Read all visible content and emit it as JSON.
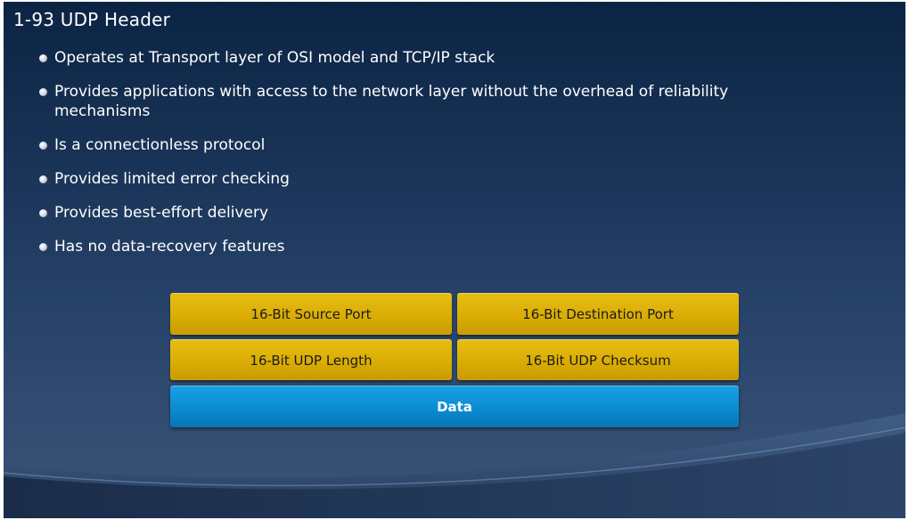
{
  "slide": {
    "title": "1-93  UDP Header",
    "bullets": [
      "Operates at Transport layer of OSI model and TCP/IP stack",
      "Provides applications with access to the network layer without the overhead of reliability mechanisms",
      "Is a connectionless protocol",
      "Provides limited error checking",
      "Provides best-effort delivery",
      "Has no data-recovery features"
    ]
  },
  "diagram": {
    "source_port": "16-Bit Source Port",
    "destination_port": "16-Bit Destination Port",
    "udp_length": "16-Bit UDP Length",
    "udp_checksum": "16-Bit UDP Checksum",
    "data": "Data"
  },
  "colors": {
    "background_top": "#0c2444",
    "background_bottom": "#3b5478",
    "header_field": "#dcae04",
    "data_field": "#0b8bd0",
    "text": "#ffffff"
  }
}
